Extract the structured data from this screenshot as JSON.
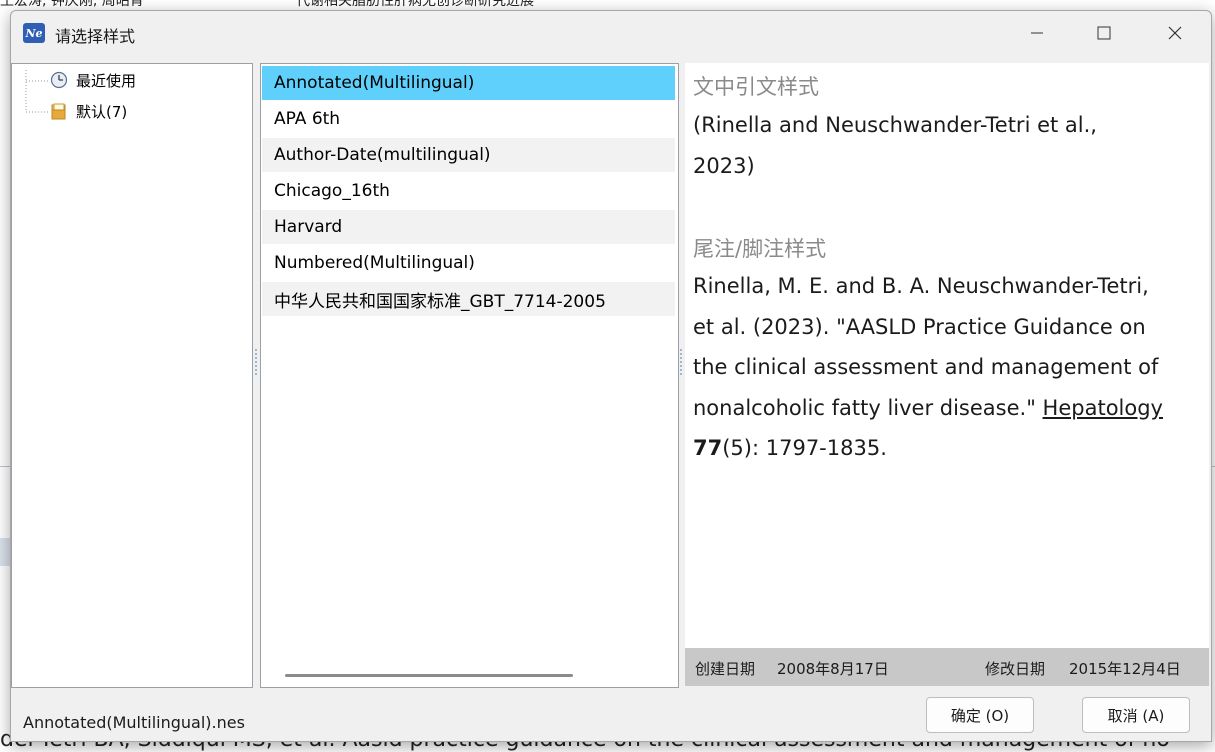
{
  "background": {
    "top_left_text": "王宏涛, 钟庆刚, 周昭宵",
    "top_right_text": "代谢相关脂肪性肝病无创诊断研究进展",
    "bottom_text": "del-Tetri BA, Siddiqui MS, et al. Aasld practice guidance on the clinical assessment and management of no"
  },
  "window": {
    "title": "请选择样式",
    "app_icon_text": "Ne",
    "minimize_icon": "minimize-icon",
    "maximize_icon": "maximize-icon",
    "close_icon": "close-icon"
  },
  "tree": {
    "items": [
      {
        "label": "最近使用",
        "icon": "clock-icon"
      },
      {
        "label": "默认(7)",
        "icon": "folder-icon"
      }
    ]
  },
  "styles": {
    "items": [
      "Annotated(Multilingual)",
      "APA 6th",
      "Author-Date(multilingual)",
      "Chicago_16th",
      "Harvard",
      "Numbered(Multilingual)",
      "中华人民共和国国家标准_GBT_7714-2005"
    ],
    "selected_index": 0
  },
  "preview": {
    "citation_heading": "文中引文样式",
    "citation_line1": "(Rinella and Neuschwander-Tetri et al.,",
    "citation_line2": "2023)",
    "footnote_heading": "尾注/脚注样式",
    "ref_line1": "Rinella, M. E. and B. A. Neuschwander-Tetri,",
    "ref_line2": "et al. (2023). \"AASLD Practice Guidance on",
    "ref_line3": "the clinical assessment and management of",
    "ref_line4_pre": "nonalcoholic fatty liver disease.\" ",
    "ref_journal": "Hepatology",
    "ref_volume": "77",
    "ref_rest": "(5): 1797-1835.",
    "created_label": "创建日期",
    "created_value": "2008年8月17日",
    "modified_label": "修改日期",
    "modified_value": "2015年12月4日"
  },
  "status": {
    "filename": "Annotated(Multilingual).nes"
  },
  "buttons": {
    "ok": "确定 (O)",
    "cancel": "取消 (A)"
  },
  "colors": {
    "selection": "#5ed0fb",
    "alt_row": "#f2f2f2",
    "footer_bar": "#c8c8c8"
  }
}
